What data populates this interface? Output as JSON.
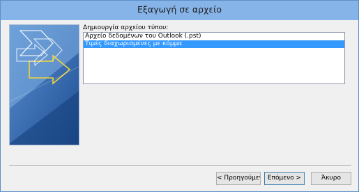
{
  "window": {
    "title": "Εξαγωγή σε αρχείο"
  },
  "illustration": {
    "icon": "export-arrows-graphic",
    "colors": {
      "dark_blue": "#2a5a9c",
      "light_blue": "#7fb0e4",
      "arrow_yellow": "#f2d33a",
      "white": "#ffffff"
    }
  },
  "main": {
    "list_label": "Δημιουργία αρχείου τύπου:",
    "file_types": [
      {
        "label": "Αρχείο δεδομένων του Outlook (.pst)",
        "selected": false
      },
      {
        "label": "Τιμές διαχωρισμένες με κόμμα",
        "selected": true
      }
    ]
  },
  "buttons": {
    "back": "< Προηγούμενο",
    "next": "Επόμενο >",
    "cancel": "Άκυρο"
  },
  "colors": {
    "titlebar": "#86b4e8",
    "window_bg": "#f0f0f0",
    "selection": "#3399ff"
  }
}
